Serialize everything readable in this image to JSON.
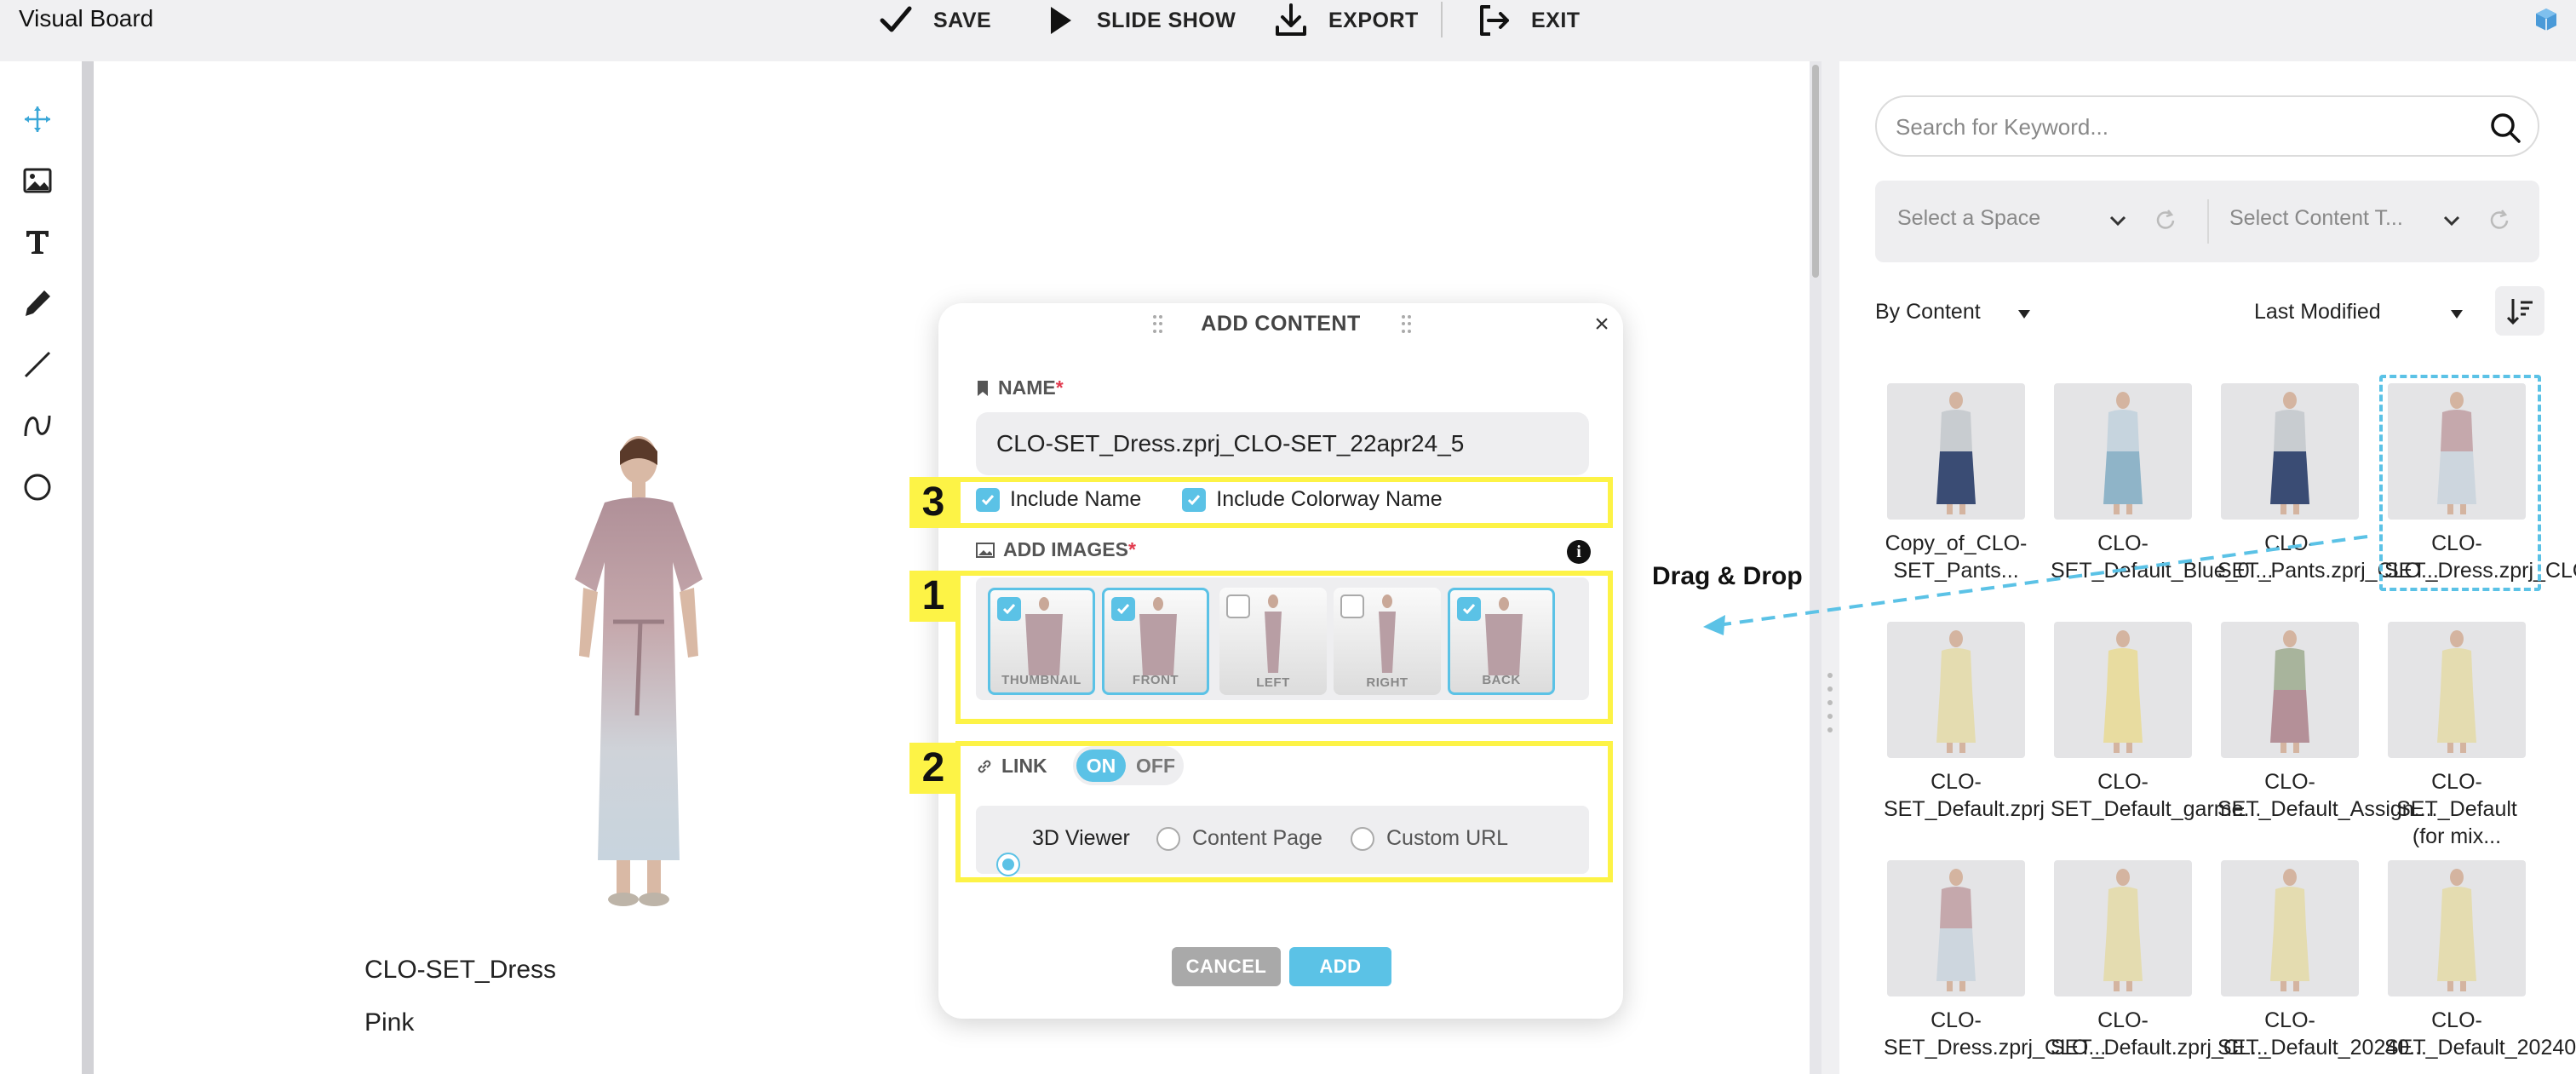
{
  "app": {
    "title": "Visual Board"
  },
  "toolbar": {
    "save": "SAVE",
    "slideshow": "SLIDE SHOW",
    "export": "EXPORT",
    "exit": "EXIT"
  },
  "left_tools": [
    "move-icon",
    "image-icon",
    "text-icon",
    "pen-icon",
    "line-icon",
    "curve-icon",
    "circle-icon"
  ],
  "canvas": {
    "item_name": "CLO-SET_Dress",
    "item_colorway": "Pink"
  },
  "search": {
    "placeholder": "Search for Keyword..."
  },
  "filters": {
    "space_placeholder": "Select a Space",
    "content_type_placeholder": "Select Content T..."
  },
  "sort": {
    "group_by": "By Content",
    "order_by": "Last Modified"
  },
  "grid_items": [
    {
      "caption": "Copy_of_CLO-SET_Pants...",
      "selected": false
    },
    {
      "caption": "CLO-SET_Default_Blue_0....",
      "selected": false
    },
    {
      "caption": "CLO-SET_Pants.zprj_CLO...",
      "selected": false
    },
    {
      "caption": "CLO-SET_Dress.zprj_CLO...",
      "selected": true
    },
    {
      "caption": "CLO-SET_Default.zprj",
      "selected": false
    },
    {
      "caption": "CLO-SET_Default_garme...",
      "selected": false
    },
    {
      "caption": "CLO-SET_Default_Assign....",
      "selected": false
    },
    {
      "caption": "CLO-SET_Default (for mix...",
      "selected": false
    },
    {
      "caption": "CLO-SET_Dress.zprj_CLO...",
      "selected": false
    },
    {
      "caption": "CLO-SET_Default.zprj_CL...",
      "selected": false
    },
    {
      "caption": "CLO-SET_Default_20240...",
      "selected": false
    },
    {
      "caption": "CLO-SET_Default_20240...",
      "selected": false
    }
  ],
  "modal": {
    "title": "ADD CONTENT",
    "name_label": "NAME",
    "required_mark": "*",
    "name_value": "CLO-SET_Dress.zprj_CLO-SET_22apr24_5",
    "include_name": "Include Name",
    "include_colorway": "Include Colorway Name",
    "add_images_label": "ADD IMAGES",
    "images": [
      {
        "label": "THUMBNAIL",
        "checked": true
      },
      {
        "label": "FRONT",
        "checked": true
      },
      {
        "label": "LEFT",
        "checked": false
      },
      {
        "label": "RIGHT",
        "checked": false
      },
      {
        "label": "BACK",
        "checked": true
      }
    ],
    "link_label": "LINK",
    "toggle_on": "ON",
    "toggle_off": "OFF",
    "link_options": [
      "3D Viewer",
      "Content Page",
      "Custom URL"
    ],
    "link_selected": "3D Viewer",
    "cancel": "CANCEL",
    "add": "ADD"
  },
  "annotations": {
    "step1": "1",
    "step2": "2",
    "step3": "3",
    "drag_drop": "Drag & Drop"
  },
  "colors": {
    "accent": "#5bc2e6",
    "highlight": "#fdf346",
    "required": "#e23a4e"
  }
}
